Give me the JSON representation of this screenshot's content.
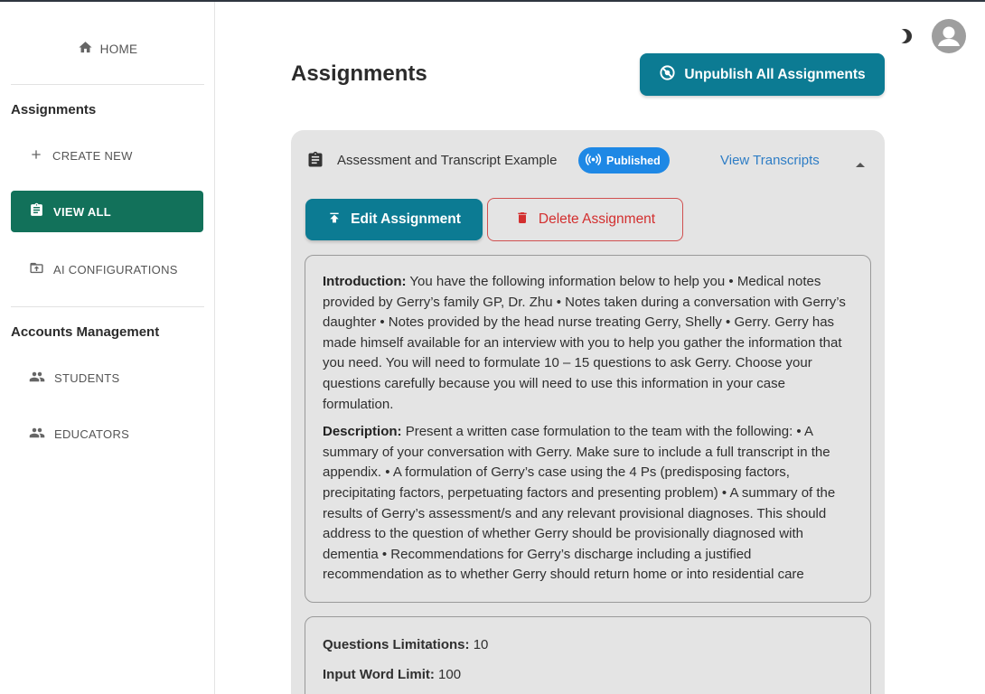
{
  "sidebar": {
    "home_label": "HOME",
    "assignments_title": "Assignments",
    "create_new_label": "CREATE NEW",
    "view_all_label": "VIEW ALL",
    "ai_config_label": "AI CONFIGURATIONS",
    "accounts_title": "Accounts Management",
    "students_label": "STUDENTS",
    "educators_label": "EDUCATORS"
  },
  "header": {
    "page_title": "Assignments",
    "unpublish_label": "Unpublish All Assignments"
  },
  "assignment": {
    "title": "Assessment and Transcript Example",
    "status_badge": "Published",
    "view_transcripts_label": "View Transcripts",
    "edit_label": "Edit Assignment",
    "delete_label": "Delete Assignment",
    "introduction_heading": "Introduction:",
    "introduction_text": "You have the following information below to help you • Medical notes provided by Gerry’s family GP, Dr. Zhu • Notes taken during a conversation with Gerry’s daughter • Notes provided by the head nurse treating Gerry, Shelly • Gerry. Gerry has made himself available for an interview with you to help you gather the information that you need. You will need to formulate 10 – 15 questions to ask Gerry. Choose your questions carefully because you will need to use this information in your case formulation.",
    "description_heading": "Description:",
    "description_text": "Present a written case formulation to the team with the following: • A summary of your conversation with Gerry. Make sure to include a full transcript in the appendix. • A formulation of Gerry’s case using the 4 Ps (predisposing factors, precipitating factors, perpetuating factors and presenting problem) • A summary of the results of Gerry’s assessment/s and any relevant provisional diagnoses. This should address to the question of whether Gerry should be provisionally diagnosed with dementia • Recommendations for Gerry’s discharge including a justified recommendation as to whether Gerry should return home or into residential care",
    "questions_limit_label": "Questions Limitations:",
    "questions_limit_value": "10",
    "word_limit_label": "Input Word Limit:",
    "word_limit_value": "100"
  },
  "colors": {
    "active_nav": "#12715a",
    "primary_button": "#0c7b93",
    "badge": "#1e88e5",
    "danger": "#d32f2f",
    "link": "#2e7dc5"
  }
}
